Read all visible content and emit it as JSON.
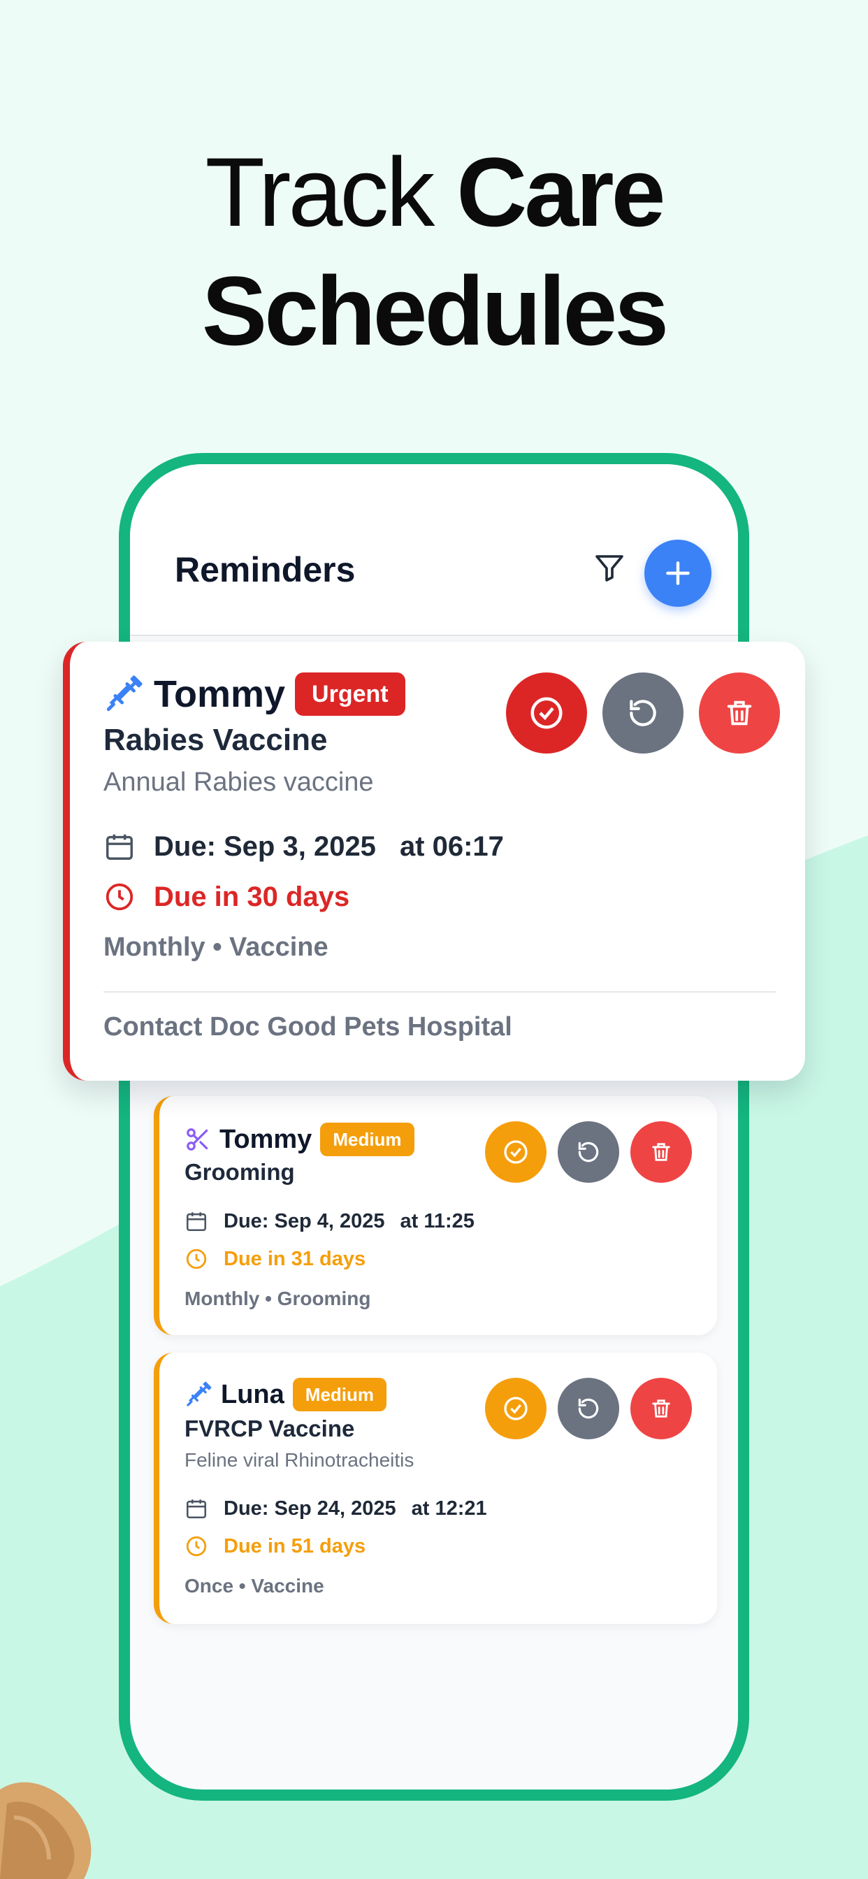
{
  "headline": {
    "light": "Track",
    "bold1": "Care",
    "bold2": "Schedules"
  },
  "app": {
    "title": "Reminders"
  },
  "colors": {
    "accent_green": "#14b57f",
    "blue": "#3b82f6",
    "urgent_red": "#dc2626",
    "medium_orange": "#f59e0b",
    "gray": "#6b7280",
    "delete_red": "#ef4444"
  },
  "featured": {
    "pet": "Tommy",
    "badge": "Urgent",
    "title": "Rabies Vaccine",
    "description": "Annual Rabies vaccine",
    "due": "Due: Sep 3, 2025",
    "time": "at 06:17",
    "due_in": "Due in 30 days",
    "meta": "Monthly • Vaccine",
    "contact": "Contact Doc Good Pets Hospital",
    "icon": "syringe-icon"
  },
  "reminders": [
    {
      "pet": "Tommy",
      "badge": "Medium",
      "title": "Grooming",
      "due": "Due: Sep 4, 2025",
      "time": "at 11:25",
      "due_in": "Due in 31 days",
      "meta": "Monthly • Grooming",
      "icon": "scissors-icon"
    },
    {
      "pet": "Luna",
      "badge": "Medium",
      "title": "FVRCP Vaccine",
      "description": "Feline viral Rhinotracheitis",
      "due": "Due: Sep 24, 2025",
      "time": "at 12:21",
      "due_in": "Due in 51 days",
      "meta": "Once • Vaccine",
      "icon": "syringe-icon"
    }
  ]
}
